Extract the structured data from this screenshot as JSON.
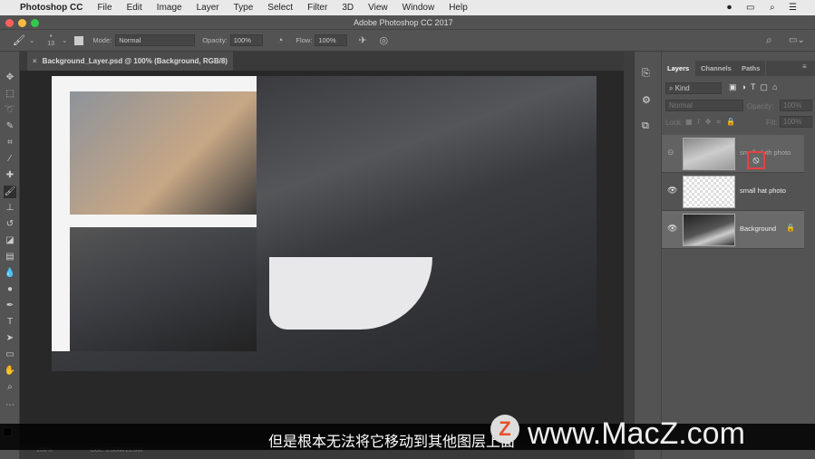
{
  "menubar": {
    "apple": "",
    "app": "Photoshop CC",
    "items": [
      "File",
      "Edit",
      "Image",
      "Layer",
      "Type",
      "Select",
      "Filter",
      "3D",
      "View",
      "Window",
      "Help"
    ]
  },
  "titlebar": {
    "title": "Adobe Photoshop CC 2017"
  },
  "options": {
    "brush_size": "13",
    "mode_label": "Mode:",
    "mode_value": "Normal",
    "opacity_label": "Opacity:",
    "opacity_value": "100%",
    "flow_label": "Flow:",
    "flow_value": "100%"
  },
  "document_tab": {
    "close": "×",
    "title": "Background_Layer.psd @ 100% (Background, RGB/8)"
  },
  "layers_panel": {
    "tabs": [
      "Layers",
      "Channels",
      "Paths"
    ],
    "filter_kind": "Kind",
    "blend_mode": "Normal",
    "opacity_label": "Opacity:",
    "opacity_value": "100%",
    "lock_label": "Lock:",
    "fill_label": "Fill:",
    "fill_value": "100%",
    "layers": [
      {
        "name": "small cloth photo",
        "visible": false
      },
      {
        "name": "small hat photo",
        "visible": true
      },
      {
        "name": "Background",
        "visible": true,
        "locked": true
      }
    ]
  },
  "status": {
    "zoom": "100%",
    "doc": "Doc: 5.58M/13.6M"
  },
  "subtitle": "但是根本无法将它移动到其他图层上面",
  "watermark": "www.MacZ.com",
  "watermark_logo": "Z"
}
